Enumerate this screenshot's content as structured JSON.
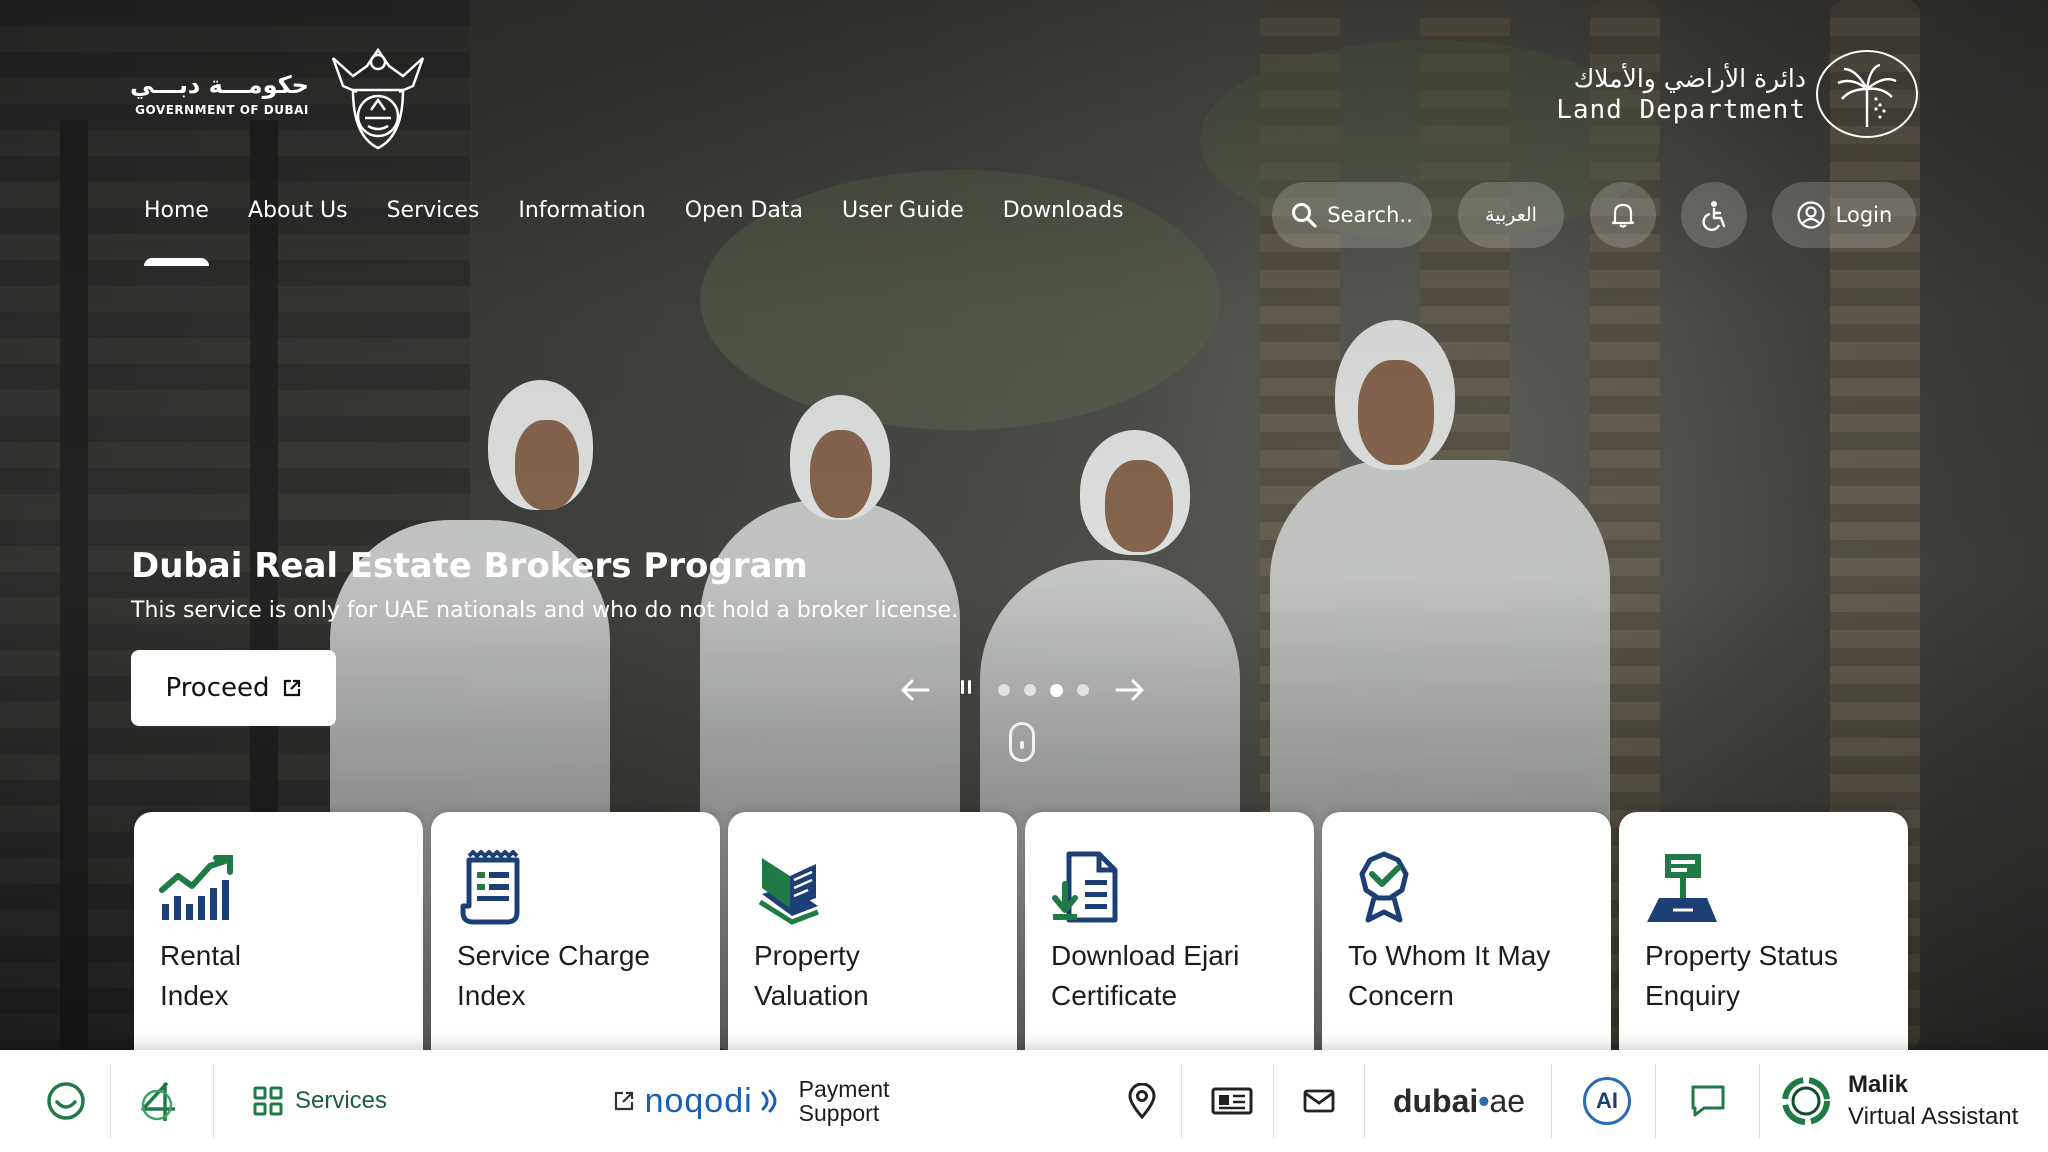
{
  "header": {
    "gov_logo_ar": "حكومـــة دبـــي",
    "gov_logo_en": "GOVERNMENT OF DUBAI",
    "dld_logo_ar": "دائرة الأراضي والأملاك",
    "dld_logo_en": "Land Department"
  },
  "nav": {
    "items": [
      {
        "label": "Home",
        "active": true
      },
      {
        "label": "About Us"
      },
      {
        "label": "Services"
      },
      {
        "label": "Information"
      },
      {
        "label": "Open Data"
      },
      {
        "label": "User Guide"
      },
      {
        "label": "Downloads"
      }
    ]
  },
  "tools": {
    "search_placeholder": "Search..",
    "language": "العربية",
    "login": "Login",
    "bell_icon": "bell-icon",
    "accessibility_icon": "wheelchair-icon"
  },
  "hero": {
    "title": "Dubai Real Estate Brokers Program",
    "subtitle": "This service is only for UAE nationals and who do not hold a broker license.",
    "button": "Proceed",
    "slide_count": 4,
    "active_slide": 3
  },
  "cards": [
    {
      "label_1": "Rental",
      "label_2": "Index",
      "icon": "chart-bars-icon"
    },
    {
      "label_1": "Service Charge",
      "label_2": "Index",
      "icon": "document-list-icon"
    },
    {
      "label_1": "Property",
      "label_2": "Valuation",
      "icon": "book-valuation-icon"
    },
    {
      "label_1": "Download Ejari",
      "label_2": "Certificate",
      "icon": "download-document-icon"
    },
    {
      "label_1": "To Whom It May",
      "label_2": "Concern",
      "icon": "badge-check-icon"
    },
    {
      "label_1": "Property Status",
      "label_2": "Enquiry",
      "icon": "property-sign-icon"
    }
  ],
  "bottom_bar": {
    "services": "Services",
    "noqodi": "noqodi",
    "payment_1": "Payment",
    "payment_2": "Support",
    "dubai": "dubai",
    "dubai_ae": "ae",
    "ai": "AI",
    "malik_name": "Malik",
    "malik_role": "Virtual Assistant"
  },
  "colors": {
    "green": "#1f7a45",
    "navy": "#1c3f75",
    "blue": "#1a5fb4"
  }
}
